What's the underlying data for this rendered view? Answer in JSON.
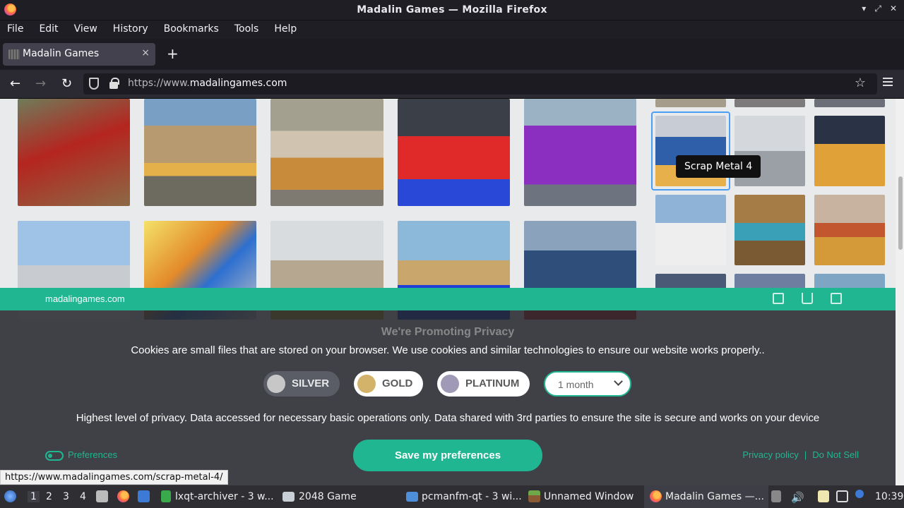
{
  "window": {
    "title": "Madalin Games — Mozilla Firefox",
    "controls": [
      "▾",
      "⤢",
      "✕"
    ]
  },
  "menu": [
    "File",
    "Edit",
    "View",
    "History",
    "Bookmarks",
    "Tools",
    "Help"
  ],
  "tab": {
    "label": "Madalin Games",
    "close": "×",
    "new": "+"
  },
  "nav": {
    "back": "←",
    "forward": "→",
    "reload": "↻",
    "url_prefix": "https://www.",
    "url_domain": "madalingames.com",
    "star": "☆"
  },
  "page": {
    "tooltip": "Scrap Metal 4",
    "status_url": "https://www.madalingames.com/scrap-metal-4/",
    "thumbs_colors": {
      "big": [
        "#8b6a45",
        "#7a8f96",
        "#9c7a52",
        "#48505c",
        "#7a5fa0",
        "#7d98b5",
        "#c7a26b",
        "#9aa0a6",
        "#5f86b0",
        "#8b8f9a"
      ],
      "small": [
        "#a59c8c",
        "#7c7a7a",
        "#6c6f77",
        "#c89a4e",
        "#c9ced4",
        "#3d5370",
        "#8fb3d6",
        "#a67c46",
        "#c7b3a0",
        "#4a5a76",
        "#6e7ea0",
        "#7fa5c4"
      ]
    }
  },
  "consent": {
    "site": "madalingames.com",
    "heading": "We're Promoting Privacy",
    "description": "Cookies are small files that are stored on your browser. We use cookies and similar technologies to ensure our website works properly..",
    "levels": [
      {
        "label": "SILVER",
        "color": "#c7c7c7"
      },
      {
        "label": "GOLD",
        "color": "#d3b36a"
      },
      {
        "label": "PLATINUM",
        "color": "#a09ab6"
      }
    ],
    "duration": "1 month",
    "level_description": "Highest level of privacy. Data accessed for necessary basic operations only. Data shared with 3rd parties to ensure the site is secure and works on your device",
    "preferences_label": "Preferences",
    "save_label": "Save my preferences",
    "privacy_policy": "Privacy policy",
    "separator": "|",
    "do_not_sell": "Do Not Sell",
    "accent": "#21b692"
  },
  "taskbar": {
    "workspaces": [
      "1",
      "2",
      "3",
      "4"
    ],
    "items": [
      {
        "label": "lxqt-archiver - 3 w...",
        "icon": "archiver-icon"
      },
      {
        "label": "2048 Game",
        "icon": "window-icon"
      },
      {
        "label": "pcmanfm-qt - 3 wi...",
        "icon": "folder-icon"
      },
      {
        "label": "Unnamed Window",
        "icon": "minecraft-icon"
      },
      {
        "label": "Madalin Games —...",
        "icon": "firefox-icon"
      }
    ],
    "clock": "10:39"
  }
}
